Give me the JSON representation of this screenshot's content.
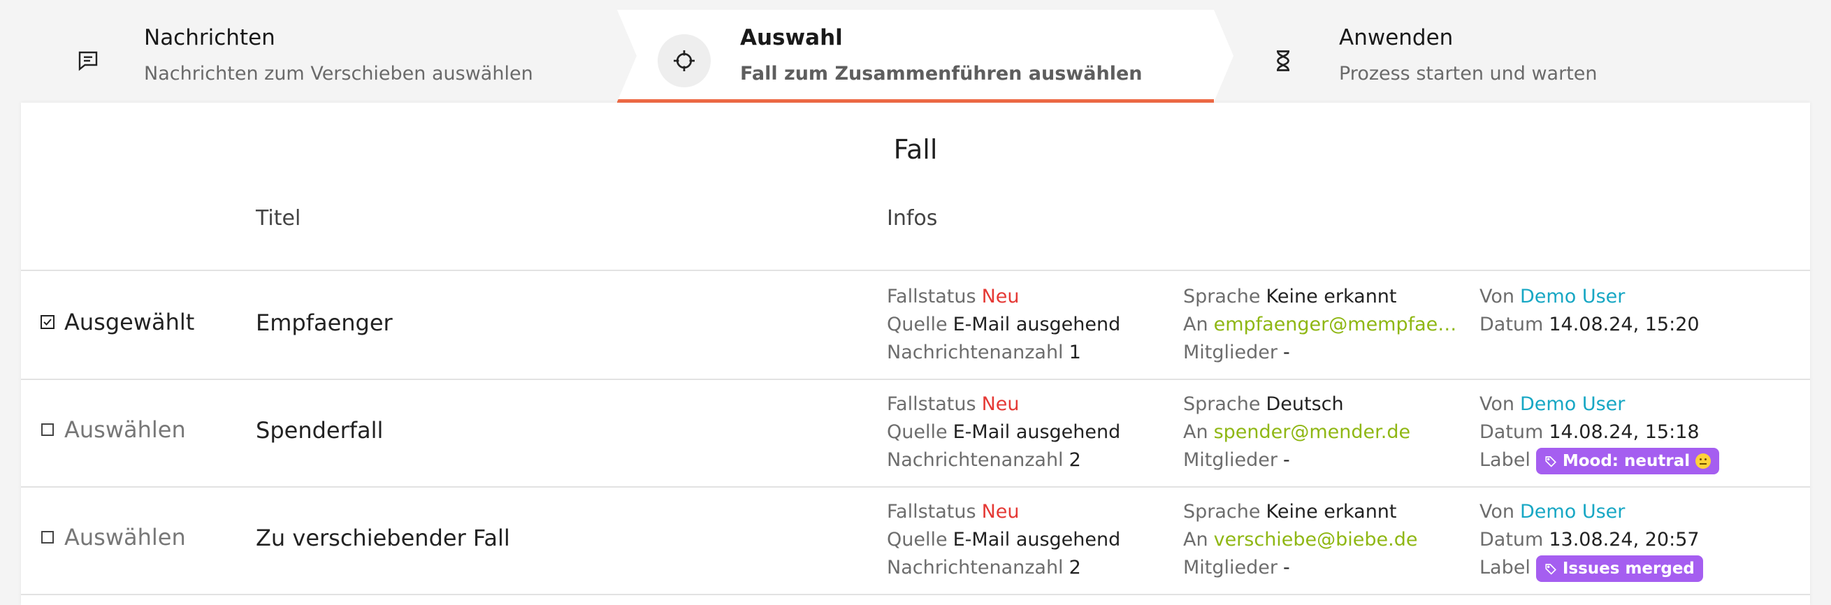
{
  "stepper": {
    "steps": [
      {
        "title": "Nachrichten",
        "subtitle": "Nachrichten zum Verschieben auswählen",
        "icon": "message-icon",
        "active": false
      },
      {
        "title": "Auswahl",
        "subtitle": "Fall zum Zusammenführen auswählen",
        "icon": "crosshair-icon",
        "active": true
      },
      {
        "title": "Anwenden",
        "subtitle": "Prozess starten und warten",
        "icon": "hourglass-icon",
        "active": false
      }
    ],
    "active_color": "#ef6a45"
  },
  "card": {
    "title": "Fall",
    "columns": {
      "titel": "Titel",
      "infos": "Infos"
    },
    "labels": {
      "fallstatus": "Fallstatus",
      "quelle": "Quelle",
      "nachrichtenanzahl": "Nachrichtenanzahl",
      "sprache": "Sprache",
      "an": "An",
      "mitglieder": "Mitglieder",
      "von": "Von",
      "datum": "Datum",
      "label": "Label"
    },
    "rows": [
      {
        "select_label": "Ausgewählt",
        "selected": true,
        "title": "Empfaenger",
        "fallstatus": "Neu",
        "quelle": "E-Mail ausgehend",
        "nachrichtenanzahl": "1",
        "sprache": "Keine erkannt",
        "an": "empfaenger@mempfaenger.de",
        "mitglieder": "-",
        "von": "Demo User",
        "datum": "14.08.24, 15:20",
        "label": ""
      },
      {
        "select_label": "Auswählen",
        "selected": false,
        "title": "Spenderfall",
        "fallstatus": "Neu",
        "quelle": "E-Mail ausgehend",
        "nachrichtenanzahl": "2",
        "sprache": "Deutsch",
        "an": "spender@mender.de",
        "mitglieder": "-",
        "von": "Demo User",
        "datum": "14.08.24, 15:18",
        "label": "Mood: neutral"
      },
      {
        "select_label": "Auswählen",
        "selected": false,
        "title": "Zu verschiebender Fall",
        "fallstatus": "Neu",
        "quelle": "E-Mail ausgehend",
        "nachrichtenanzahl": "2",
        "sprache": "Keine erkannt",
        "an": "verschiebe@biebe.de",
        "mitglieder": "-",
        "von": "Demo User",
        "datum": "13.08.24, 20:57",
        "label": "Issues merged"
      }
    ],
    "colors": {
      "status": "#e53935",
      "user": "#17a7c4",
      "email": "#8fb714",
      "badge": "#a55ef0"
    }
  }
}
